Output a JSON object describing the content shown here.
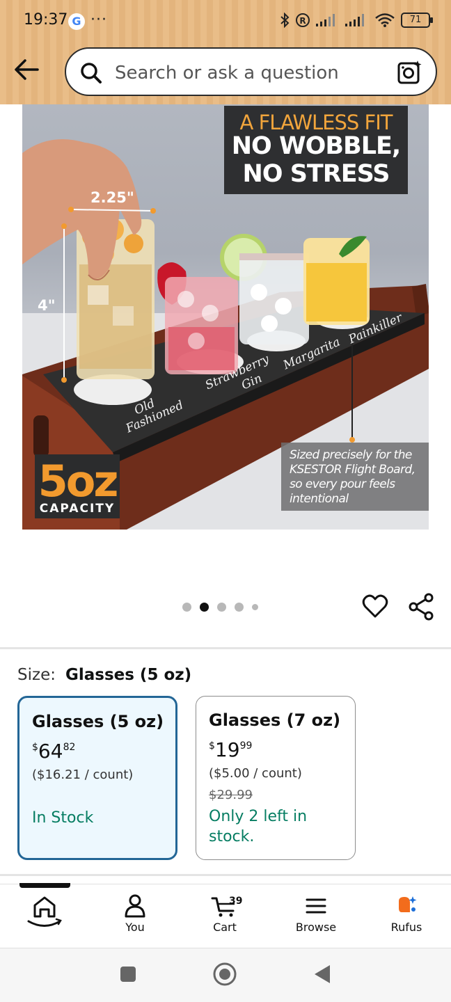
{
  "status_bar": {
    "time": "19:37",
    "google_badge": "G",
    "overflow": "···",
    "battery": "71"
  },
  "search": {
    "placeholder": "Search or ask a question"
  },
  "product_image": {
    "headline_1": "A FLAWLESS FIT",
    "headline_2": "NO WOBBLE,",
    "headline_3": "NO STRESS",
    "dim_width": "2.25\"",
    "dim_height": "4\"",
    "board_labels": [
      "Old",
      "Fashioned",
      "Strawberry",
      "Gin",
      "Margarita",
      "Painkiller"
    ],
    "capacity_value": "5oz",
    "capacity_label": "CAPACITY",
    "caption": "Sized precisely for the KSESTOR Flight Board, so every pour feels intentional"
  },
  "carousel": {
    "count": 5,
    "active_index": 1
  },
  "size": {
    "label": "Size:",
    "selected": "Glasses (5 oz)",
    "options": [
      {
        "title": "Glasses (5 oz)",
        "price_whole": "64",
        "price_fraction": "82",
        "currency": "$",
        "unit_price": "($16.21 / count)",
        "list_price": "",
        "stock": "In Stock"
      },
      {
        "title": "Glasses (7 oz)",
        "price_whole": "19",
        "price_fraction": "99",
        "currency": "$",
        "unit_price": "($5.00 / count)",
        "list_price": "$29.99",
        "stock": "Only 2 left in stock."
      }
    ]
  },
  "bottom_nav": {
    "items": [
      {
        "label": "",
        "icon": "home-icon"
      },
      {
        "label": "You",
        "icon": "person-icon"
      },
      {
        "label": "Cart",
        "icon": "cart-icon",
        "count": "39"
      },
      {
        "label": "Browse",
        "icon": "menu-icon"
      },
      {
        "label": "Rufus",
        "icon": "rufus-icon"
      }
    ]
  },
  "colors": {
    "header": "#e9bd88",
    "selected_card_border": "#236696",
    "selected_card_bg": "#edf8fe",
    "stock_green": "#067d62",
    "accent_orange": "#f29a2e"
  }
}
